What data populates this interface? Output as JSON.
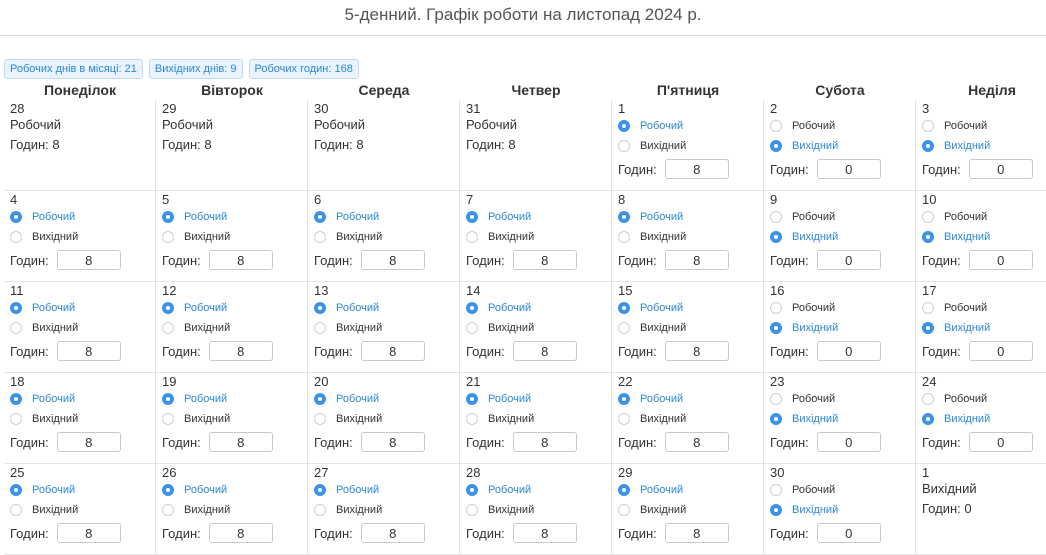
{
  "title": "5-денний. Графік роботи на листопад 2024 р.",
  "badges": [
    {
      "label": "Робочих днів в місяці: 21"
    },
    {
      "label": "Вихідних днів: 9"
    },
    {
      "label": "Робочих годин: 168"
    }
  ],
  "labels": {
    "work": "Робочий",
    "off": "Вихідний",
    "hours": "Годин:"
  },
  "weekdays": [
    "Понеділок",
    "Вівторок",
    "Середа",
    "Четвер",
    "П'ятниця",
    "Субота",
    "Неділя"
  ],
  "days": [
    {
      "num": "28",
      "kind": "static",
      "status": "Робочий",
      "hours_text": "Годин: 8"
    },
    {
      "num": "29",
      "kind": "static",
      "status": "Робочий",
      "hours_text": "Годин: 8"
    },
    {
      "num": "30",
      "kind": "static",
      "status": "Робочий",
      "hours_text": "Годин: 8"
    },
    {
      "num": "31",
      "kind": "static",
      "status": "Робочий",
      "hours_text": "Годин: 8"
    },
    {
      "num": "1",
      "kind": "edit",
      "selected": "work",
      "hours": "8"
    },
    {
      "num": "2",
      "kind": "edit",
      "selected": "off",
      "hours": "0"
    },
    {
      "num": "3",
      "kind": "edit",
      "selected": "off",
      "hours": "0"
    },
    {
      "num": "4",
      "kind": "edit",
      "selected": "work",
      "hours": "8"
    },
    {
      "num": "5",
      "kind": "edit",
      "selected": "work",
      "hours": "8"
    },
    {
      "num": "6",
      "kind": "edit",
      "selected": "work",
      "hours": "8"
    },
    {
      "num": "7",
      "kind": "edit",
      "selected": "work",
      "hours": "8"
    },
    {
      "num": "8",
      "kind": "edit",
      "selected": "work",
      "hours": "8"
    },
    {
      "num": "9",
      "kind": "edit",
      "selected": "off",
      "hours": "0"
    },
    {
      "num": "10",
      "kind": "edit",
      "selected": "off",
      "hours": "0"
    },
    {
      "num": "11",
      "kind": "edit",
      "selected": "work",
      "hours": "8"
    },
    {
      "num": "12",
      "kind": "edit",
      "selected": "work",
      "hours": "8"
    },
    {
      "num": "13",
      "kind": "edit",
      "selected": "work",
      "hours": "8"
    },
    {
      "num": "14",
      "kind": "edit",
      "selected": "work",
      "hours": "8"
    },
    {
      "num": "15",
      "kind": "edit",
      "selected": "work",
      "hours": "8"
    },
    {
      "num": "16",
      "kind": "edit",
      "selected": "off",
      "hours": "0"
    },
    {
      "num": "17",
      "kind": "edit",
      "selected": "off",
      "hours": "0"
    },
    {
      "num": "18",
      "kind": "edit",
      "selected": "work",
      "hours": "8"
    },
    {
      "num": "19",
      "kind": "edit",
      "selected": "work",
      "hours": "8"
    },
    {
      "num": "20",
      "kind": "edit",
      "selected": "work",
      "hours": "8"
    },
    {
      "num": "21",
      "kind": "edit",
      "selected": "work",
      "hours": "8"
    },
    {
      "num": "22",
      "kind": "edit",
      "selected": "work",
      "hours": "8"
    },
    {
      "num": "23",
      "kind": "edit",
      "selected": "off",
      "hours": "0"
    },
    {
      "num": "24",
      "kind": "edit",
      "selected": "off",
      "hours": "0"
    },
    {
      "num": "25",
      "kind": "edit",
      "selected": "work",
      "hours": "8"
    },
    {
      "num": "26",
      "kind": "edit",
      "selected": "work",
      "hours": "8"
    },
    {
      "num": "27",
      "kind": "edit",
      "selected": "work",
      "hours": "8"
    },
    {
      "num": "28",
      "kind": "edit",
      "selected": "work",
      "hours": "8"
    },
    {
      "num": "29",
      "kind": "edit",
      "selected": "work",
      "hours": "8"
    },
    {
      "num": "30",
      "kind": "edit",
      "selected": "off",
      "hours": "0"
    },
    {
      "num": "1",
      "kind": "static",
      "status": "Вихідний",
      "hours_text": "Годин: 0"
    }
  ]
}
